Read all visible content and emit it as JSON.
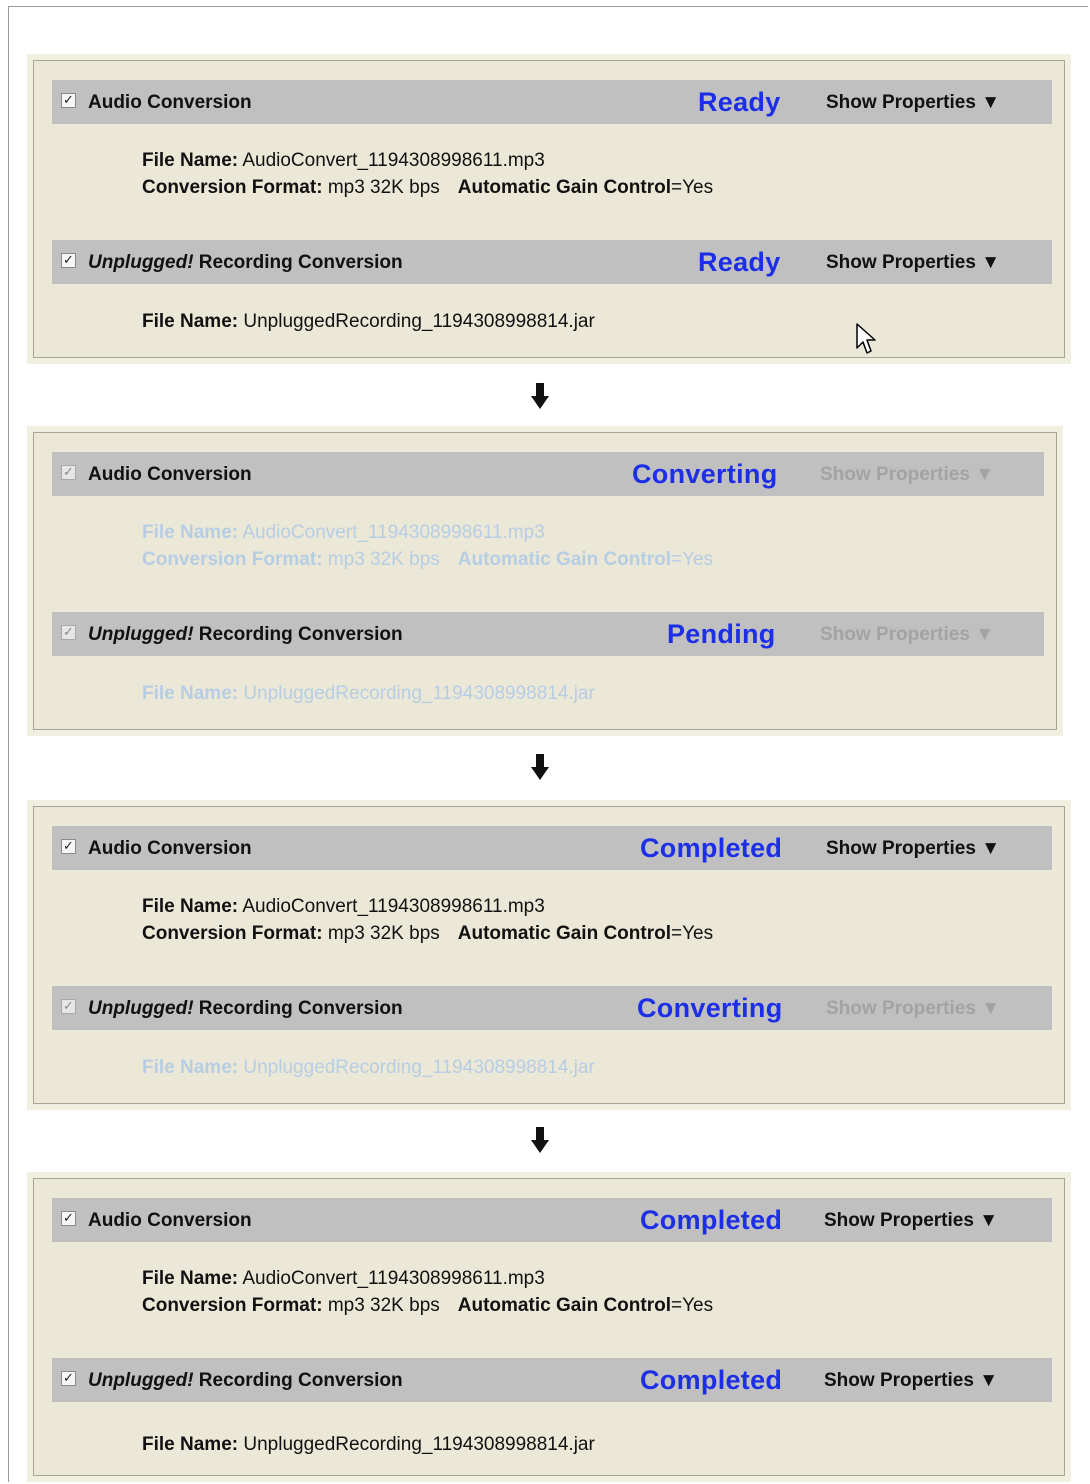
{
  "labels": {
    "file_name": "File Name:",
    "conversion_format": "Conversion Format:",
    "automatic_gain_control": "Automatic Gain Control",
    "show_properties": "Show Properties"
  },
  "jobs": {
    "audio_title": "Audio Conversion",
    "unplugged_italic": "Unplugged!",
    "unplugged_title_rest": " Recording Conversion",
    "audio_file": "AudioConvert_1194308998611.mp3",
    "audio_format": "mp3 32K bps",
    "audio_agc": "=Yes",
    "unplugged_file": "UnpluggedRecording_1194308998814.jar"
  },
  "checkbox_mark": "✓",
  "dropdown_arrow": "▼",
  "step_arrow_icon": "down-arrow-icon",
  "colors": {
    "status_blue": "#1c2ee6",
    "bar_gray": "#c0c0c0",
    "panel_beige": "#ebe8d8",
    "dimmed_text": "#b7cde4"
  },
  "steps": [
    {
      "audio_status": "Ready",
      "unplugged_status": "Ready"
    },
    {
      "audio_status": "Converting",
      "unplugged_status": "Pending"
    },
    {
      "audio_status": "Completed",
      "unplugged_status": "Converting"
    },
    {
      "audio_status": "Completed",
      "unplugged_status": "Completed"
    }
  ]
}
